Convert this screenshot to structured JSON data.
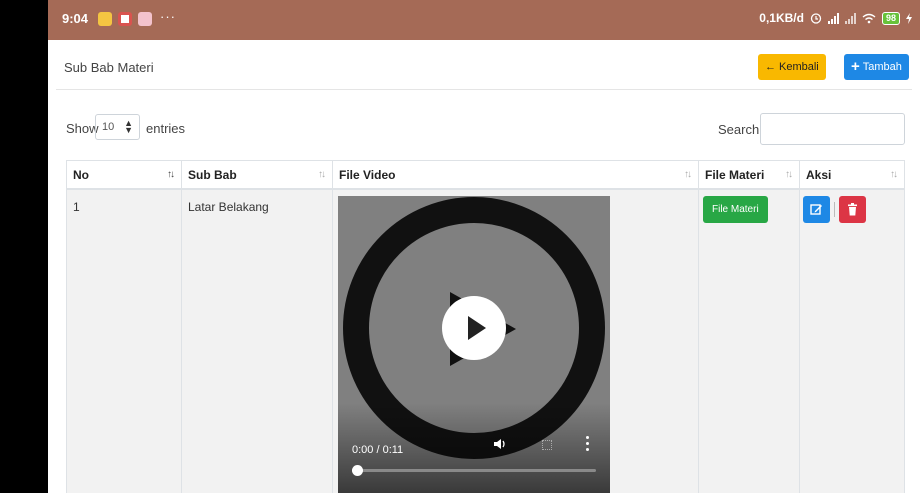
{
  "status_bar": {
    "time": "9:04",
    "dots": "···",
    "network_speed": "0,1KB/d",
    "battery": "98"
  },
  "header": {
    "title": "Sub Bab Materi",
    "back_label": "Kembali",
    "add_label": "Tambah"
  },
  "controls": {
    "show_label": "Show",
    "entries_value": "10",
    "entries_label": "entries",
    "search_label": "Search:",
    "search_value": ""
  },
  "table": {
    "columns": [
      "No",
      "Sub Bab",
      "File Video",
      "File Materi",
      "Aksi"
    ],
    "rows": [
      {
        "no": "1",
        "sub_bab": "Latar Belakang",
        "video_time": "0:00 / 0:11",
        "video_progress": 0.02,
        "file_materi_label": "File Materi"
      }
    ]
  },
  "colors": {
    "status_bar": "#a56a56",
    "back_button": "#f9b800",
    "add_button": "#1e88e5",
    "materi_button": "#28a745",
    "edit_button": "#1e88e5",
    "delete_button": "#dc3545"
  },
  "icons": [
    "arrow-left-icon",
    "plus-icon",
    "sort-icon",
    "play-icon",
    "volume-icon",
    "fullscreen-icon",
    "more-vert-icon",
    "edit-icon",
    "trash-icon",
    "wifi-icon",
    "signal-icon",
    "battery-icon",
    "alarm-icon"
  ]
}
